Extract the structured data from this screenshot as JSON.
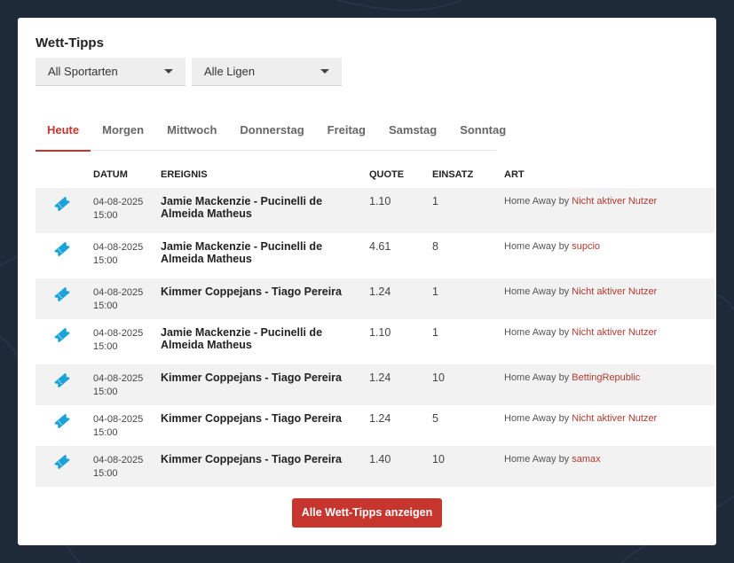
{
  "widget": {
    "title": "Wett-Tipps",
    "sport_select": "All Sportarten",
    "league_select": "Alle Ligen",
    "cta_label": "Alle Wett-Tipps anzeigen"
  },
  "tabs": [
    {
      "label": "Heute",
      "active": true
    },
    {
      "label": "Morgen",
      "active": false
    },
    {
      "label": "Mittwoch",
      "active": false
    },
    {
      "label": "Donnerstag",
      "active": false
    },
    {
      "label": "Freitag",
      "active": false
    },
    {
      "label": "Samstag",
      "active": false
    },
    {
      "label": "Sonntag",
      "active": false
    }
  ],
  "table": {
    "headers": {
      "datum": "DATUM",
      "ereignis": "EREIGNIS",
      "quote": "QUOTE",
      "einsatz": "EINSATZ",
      "art": "ART"
    },
    "rows": [
      {
        "icon": "ticket-icon",
        "date": "04-08-2025",
        "time": "15:00",
        "event": "Jamie Mackenzie - Pucinelli de Almeida Matheus",
        "quote": "1.10",
        "stake": "1",
        "art": "Home Away",
        "by": "by",
        "user": "Nicht aktiver Nutzer"
      },
      {
        "icon": "ticket-icon",
        "date": "04-08-2025",
        "time": "15:00",
        "event": "Jamie Mackenzie - Pucinelli de Almeida Matheus",
        "quote": "4.61",
        "stake": "8",
        "art": "Home Away",
        "by": "by",
        "user": "supcio"
      },
      {
        "icon": "ticket-icon",
        "date": "04-08-2025",
        "time": "15:00",
        "event": "Kimmer Coppejans - Tiago Pereira",
        "quote": "1.24",
        "stake": "1",
        "art": "Home Away",
        "by": "by",
        "user": "Nicht aktiver Nutzer"
      },
      {
        "icon": "ticket-icon",
        "date": "04-08-2025",
        "time": "15:00",
        "event": "Jamie Mackenzie - Pucinelli de Almeida Matheus",
        "quote": "1.10",
        "stake": "1",
        "art": "Home Away",
        "by": "by",
        "user": "Nicht aktiver Nutzer"
      },
      {
        "icon": "ticket-icon",
        "date": "04-08-2025",
        "time": "15:00",
        "event": "Kimmer Coppejans - Tiago Pereira",
        "quote": "1.24",
        "stake": "10",
        "art": "Home Away",
        "by": "by",
        "user": "BettingRepublic"
      },
      {
        "icon": "ticket-icon",
        "date": "04-08-2025",
        "time": "15:00",
        "event": "Kimmer Coppejans - Tiago Pereira",
        "quote": "1.24",
        "stake": "5",
        "art": "Home Away",
        "by": "by",
        "user": "Nicht aktiver Nutzer"
      },
      {
        "icon": "ticket-icon",
        "date": "04-08-2025",
        "time": "15:00",
        "event": "Kimmer Coppejans - Tiago Pereira",
        "quote": "1.40",
        "stake": "10",
        "art": "Home Away",
        "by": "by",
        "user": "samax"
      }
    ]
  },
  "colors": {
    "accent": "#c6362f",
    "user_link": "#b03a2e",
    "icon": "#1aa3d9",
    "background": "#1e2a38"
  }
}
